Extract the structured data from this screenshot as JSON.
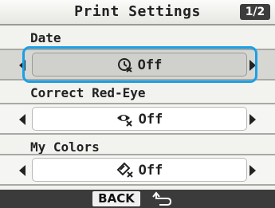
{
  "header": {
    "title": "Print Settings",
    "page": "1/2"
  },
  "settings": [
    {
      "label": "Date",
      "value": "Off",
      "icon": "date-stamp-icon",
      "selected": true
    },
    {
      "label": "Correct Red-Eye",
      "value": "Off",
      "icon": "red-eye-icon",
      "selected": false
    },
    {
      "label": "My Colors",
      "value": "Off",
      "icon": "my-colors-icon",
      "selected": false
    }
  ],
  "footer": {
    "back_label": "BACK",
    "back_icon": "return-arrow-icon"
  },
  "colors": {
    "focus": "#1aa0e6",
    "footer_bg": "#3b3b3b",
    "badge_bg": "#3c3c3c"
  }
}
